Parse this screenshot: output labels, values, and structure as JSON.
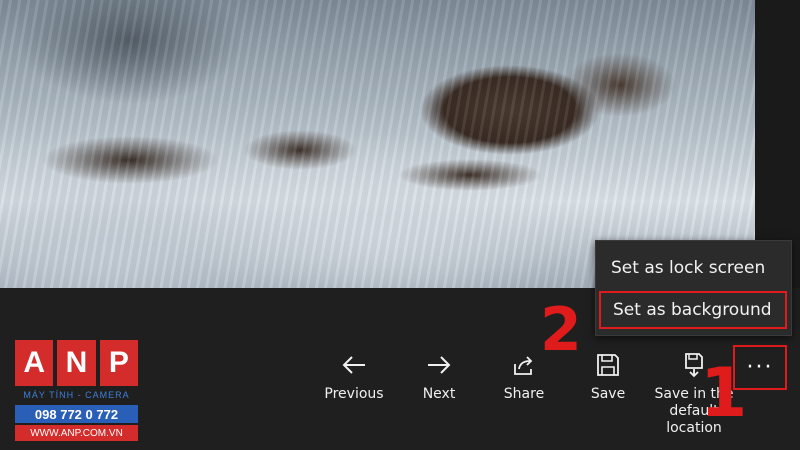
{
  "toolbar": {
    "previous_label": "Previous",
    "next_label": "Next",
    "share_label": "Share",
    "save_label": "Save",
    "save_default_label": "Save in the default location",
    "more_label": "···"
  },
  "context_menu": {
    "items": [
      {
        "label": "Set as lock screen"
      },
      {
        "label": "Set as background"
      }
    ]
  },
  "annotations": {
    "step_1": "1",
    "step_2": "2"
  },
  "watermark": {
    "letters": [
      "A",
      "N",
      "P"
    ],
    "tagline": "MÁY TÍNH - CAMERA",
    "phone": "098 772 0 772",
    "website": "WWW.ANP.COM.VN"
  },
  "colors": {
    "highlight": "#e01b1b",
    "bar_background": "#1f1f1f",
    "menu_background": "#2b2b2b"
  }
}
